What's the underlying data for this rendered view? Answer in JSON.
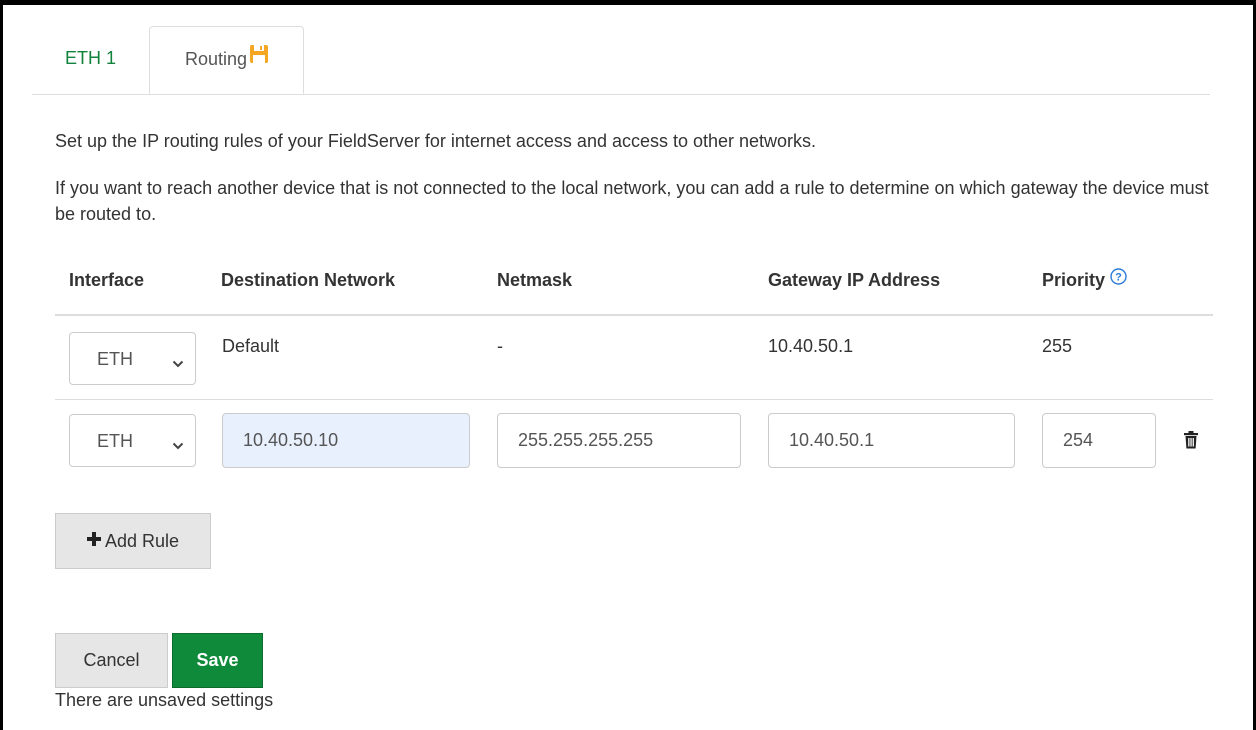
{
  "tabs": [
    {
      "label": "ETH 1"
    },
    {
      "label": "Routing",
      "icon": "save-icon",
      "icon_color": "#f5a623"
    }
  ],
  "description": {
    "line1": "Set up the IP routing rules of your FieldServer for internet access and access to other networks.",
    "line2": "If you want to reach another device that is not connected to the local network, you can add a rule to determine on which gateway the device must be routed to."
  },
  "table": {
    "headers": {
      "interface": "Interface",
      "destination": "Destination Network",
      "netmask": "Netmask",
      "gateway": "Gateway IP Address",
      "priority": "Priority"
    },
    "rows": [
      {
        "interface": "ETH",
        "destination": "Default",
        "netmask": "-",
        "gateway": "10.40.50.1",
        "priority": "255"
      },
      {
        "interface": "ETH",
        "destination": "10.40.50.10",
        "netmask": "255.255.255.255",
        "gateway": "10.40.50.1",
        "priority": "254"
      }
    ]
  },
  "buttons": {
    "add_rule": "Add Rule",
    "cancel": "Cancel",
    "save": "Save"
  },
  "status_text": "There are unsaved settings",
  "colors": {
    "accent_green": "#11823b",
    "save_green": "#0f8a3a",
    "focus_blue": "#e8f0fe",
    "help_blue": "#2b7bd8"
  }
}
